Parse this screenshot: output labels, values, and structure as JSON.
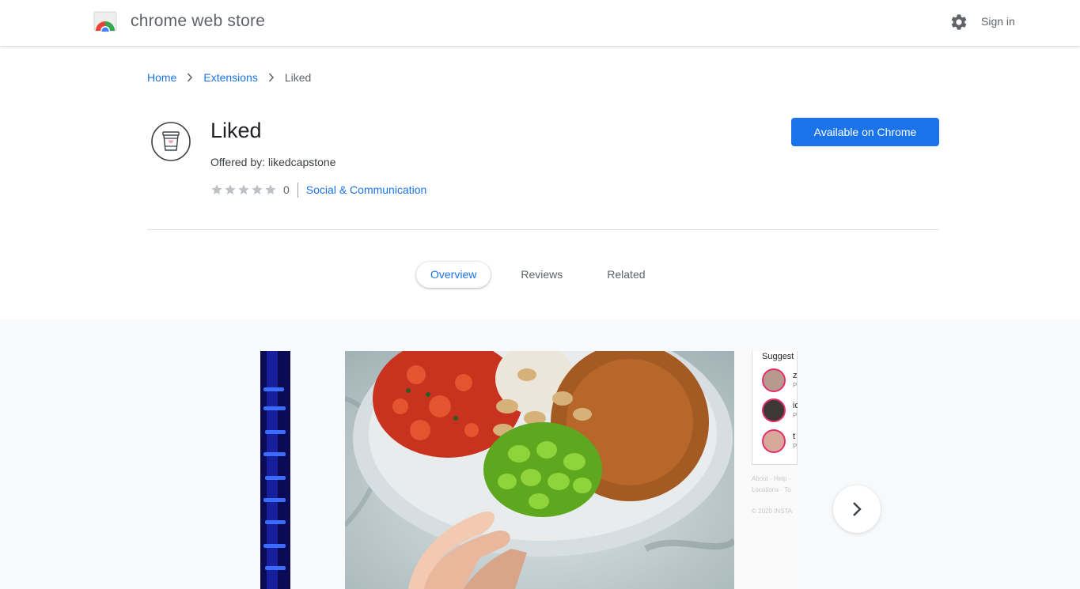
{
  "header": {
    "brand": "chrome web store",
    "sign_in": "Sign in",
    "icons": {
      "logo": "chrome-web-store-logo",
      "settings": "gear-icon"
    }
  },
  "breadcrumb": {
    "home": "Home",
    "extensions": "Extensions",
    "current": "Liked"
  },
  "item": {
    "title": "Liked",
    "offered_by": "Offered by: likedcapstone",
    "rating": 0,
    "rating_count": "0",
    "category": "Social & Communication",
    "install_label": "Available on Chrome"
  },
  "tabs": [
    {
      "label": "Overview",
      "active": true
    },
    {
      "label": "Reviews",
      "active": false
    },
    {
      "label": "Related",
      "active": false
    }
  ],
  "gallery": {
    "side_panel": {
      "title": "Suggest",
      "users": [
        {
          "name": "z",
          "sub": "P"
        },
        {
          "name": "ic",
          "sub": "P"
        },
        {
          "name": "t",
          "sub": "P"
        }
      ],
      "footer_lines": [
        "About · Help ·",
        "Locations · To",
        "© 2020 INSTA"
      ]
    }
  },
  "colors": {
    "accent": "#1a73e8",
    "text_secondary": "#5f6368",
    "gallery_bg": "#f8f9fa"
  }
}
